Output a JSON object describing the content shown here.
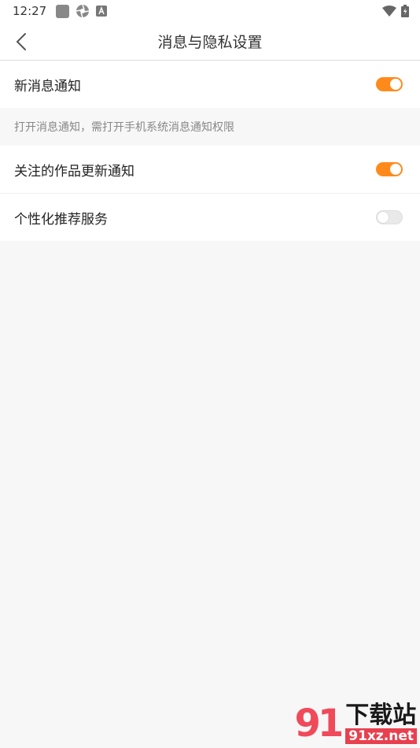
{
  "status_bar": {
    "time": "12:27",
    "icons": [
      "gallery-icon",
      "aperture-icon",
      "app-a-icon",
      "wifi-icon",
      "battery-charging-icon"
    ]
  },
  "navbar": {
    "title": "消息与隐私设置",
    "back_icon": "chevron-left-icon"
  },
  "settings": {
    "new_message": {
      "label": "新消息通知",
      "enabled": true
    },
    "hint": "打开消息通知，需打开手机系统消息通知权限",
    "follow_updates": {
      "label": "关注的作品更新通知",
      "enabled": true
    },
    "personalized": {
      "label": "个性化推荐服务",
      "enabled": false
    }
  },
  "watermark": {
    "logo": "91",
    "text": "下载站",
    "url": "91xz.net"
  },
  "colors": {
    "accent": "#ff8a1c",
    "toggle_off": "#e9e9e9",
    "background": "#f7f7f7"
  }
}
